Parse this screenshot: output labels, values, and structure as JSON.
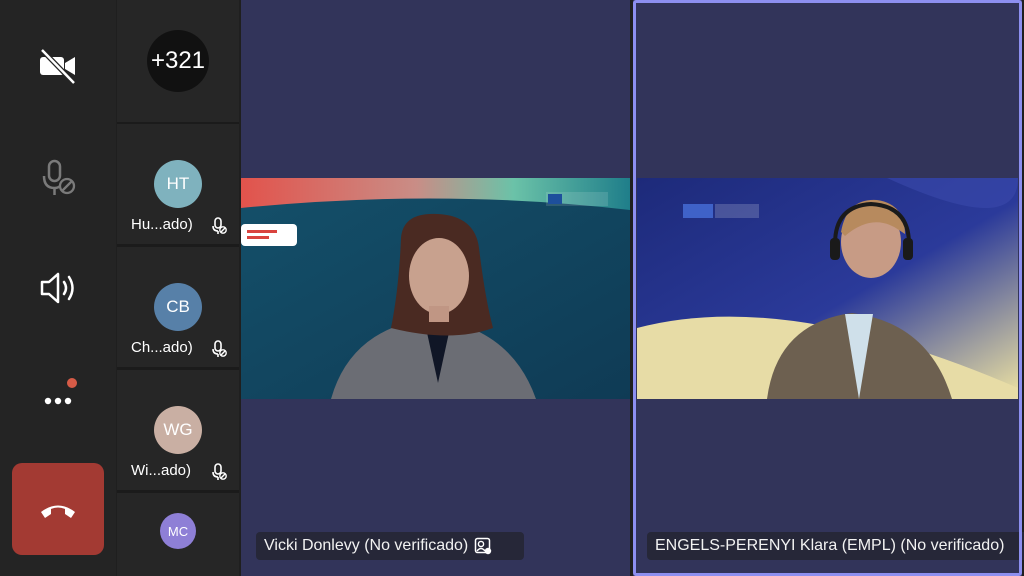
{
  "controls": {
    "camera": "camera-off-icon",
    "mic": "mic-off-icon",
    "speaker": "speaker-icon",
    "more": "more-icon",
    "hangup": "hang-up-icon",
    "hangup_color": "#a33a33",
    "notification_dot_color": "#d65b47"
  },
  "roster": {
    "overflow_count": "+321",
    "participants": [
      {
        "initials": "HT",
        "name": "Hu...ado)",
        "color": "#7fb2be"
      },
      {
        "initials": "CB",
        "name": "Ch...ado)",
        "color": "#5780a8"
      },
      {
        "initials": "WG",
        "name": "Wi...ado)",
        "color": "#c9afa3"
      },
      {
        "initials": "MC",
        "name": "",
        "color": "#8e7fd6"
      }
    ]
  },
  "tiles": [
    {
      "name": "Vicki Donlevy (No verificado)",
      "banner": "PACT FOR SKILLS",
      "logo": "European Commission"
    },
    {
      "name": "ENGELS-PERENYI Klara (EMPL) (No verificado)",
      "logo": "European Commission",
      "active_border_color": "#8d8ff0"
    }
  ]
}
